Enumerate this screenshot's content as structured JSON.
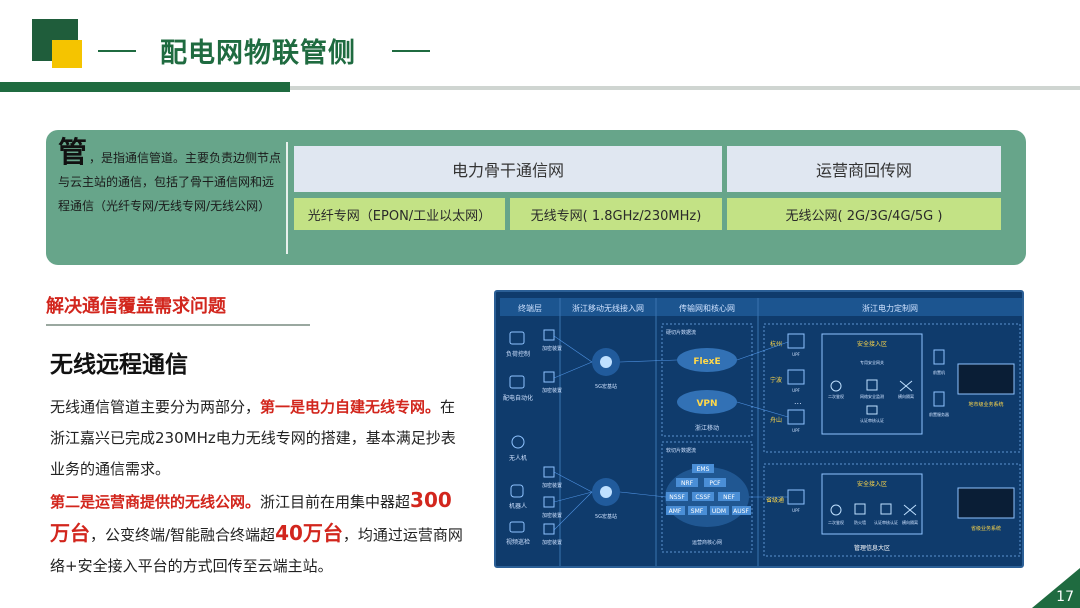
{
  "slide": {
    "title": "配电网物联管侧",
    "page_number": "17"
  },
  "pipe_panel": {
    "big_char": "管",
    "description": "，是指通信管道。主要负责边侧节点与云主站的通信，包括了骨干通信网和远程通信（光纤专网/无线专网/无线公网）",
    "headers": [
      "电力骨干通信网",
      "运营商回传网"
    ],
    "items": [
      "光纤专网（EPON/工业以太网）",
      "无线专网( 1.8GHz/230MHz)",
      "无线公网( 2G/3G/4G/5G )"
    ]
  },
  "section": {
    "title": "解决通信覆盖需求问题",
    "subject": "无线远程通信",
    "p1_a": "无线通信管道主要分为两部分，",
    "p1_red": "第一是电力自建无线专网。",
    "p1_b": "在浙江嘉兴已完成230MHz电力无线专网的搭建，基本满足抄表业务的通信需求。",
    "p2_red": "第二是运营商提供的无线公网。",
    "p2_a": "浙江目前在用集中器超",
    "num1": "300万台",
    "p2_b": "，公变终端/智能融合终端超",
    "num2": "40万台",
    "p2_c": "，均通过运营商网络+安全接入平台的方式回传至云端主站。"
  },
  "diagram": {
    "columns": [
      "终端层",
      "浙江移动无线接入网",
      "传输网和核心网",
      "浙江电力定制网"
    ],
    "terminals": [
      "负荷控制",
      "配电自动化",
      "无人机",
      "机器人",
      "视频巡检"
    ],
    "slice_devices": [
      "加密装置",
      "加密装置",
      "加密装置",
      "加密装置",
      "加密装置"
    ],
    "base_station": "5G宏基站",
    "core_top_label": "硬切片数据流",
    "flexe": "FlexE",
    "vpn": "VPN",
    "zj_mobile": "浙江移动",
    "core_bottom_label": "软切片数据流",
    "nf": [
      "EMS",
      "NRF",
      "PCF",
      "NSSF",
      "CSSF",
      "NEF",
      "AMF",
      "SMF",
      "UDM",
      "AUSF"
    ],
    "core_caption": "运营商核心网",
    "cities": [
      "杭州",
      "宁波",
      "舟山",
      "省级通"
    ],
    "upf": "UPF",
    "dots": "...",
    "secure_zone": "安全接入区",
    "secure_items": [
      "专用安全网关",
      "二次鉴权",
      "网络安全监测",
      "横向隔离",
      "认证审核认证"
    ],
    "secure_items2": [
      "二次鉴权",
      "防火墙",
      "认证审核认证",
      "横向隔离"
    ],
    "right_devices": [
      "前置机",
      "前置服务器"
    ],
    "biz_system1": "地市级业务系统",
    "biz_system2": "省级业务系统",
    "mgmt_zone": "管理信息大区"
  }
}
